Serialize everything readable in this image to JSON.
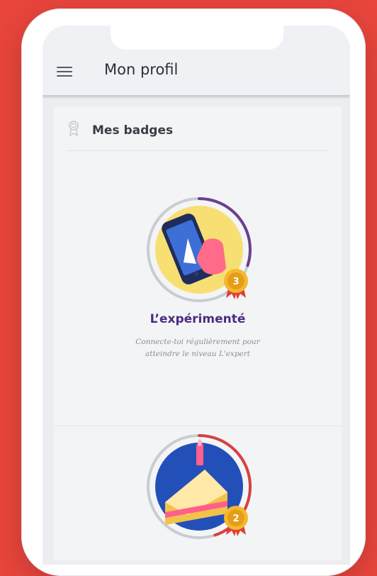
{
  "header": {
    "title": "Mon profil",
    "menu_icon": "hamburger-menu-icon"
  },
  "badges_section": {
    "title": "Mes badges",
    "icon": "medal-outline-icon",
    "items": [
      {
        "name": "L’expérimenté",
        "description": "Connecte-toi régulièrement pour atteindre le niveau L'expert",
        "level": "3",
        "illustration": "phone-in-hand-icon",
        "progress": 0.3
      },
      {
        "name": "",
        "description": "",
        "level": "2",
        "illustration": "birthday-cake-icon",
        "progress": 0.45
      }
    ]
  },
  "colors": {
    "background": "#e8453c",
    "badge_title": "#4b2d7f",
    "progress_purple": "#6b3f8e",
    "progress_red": "#d8403f",
    "medal_gold": "#f5b82e",
    "ribbon_red": "#e23c35"
  }
}
